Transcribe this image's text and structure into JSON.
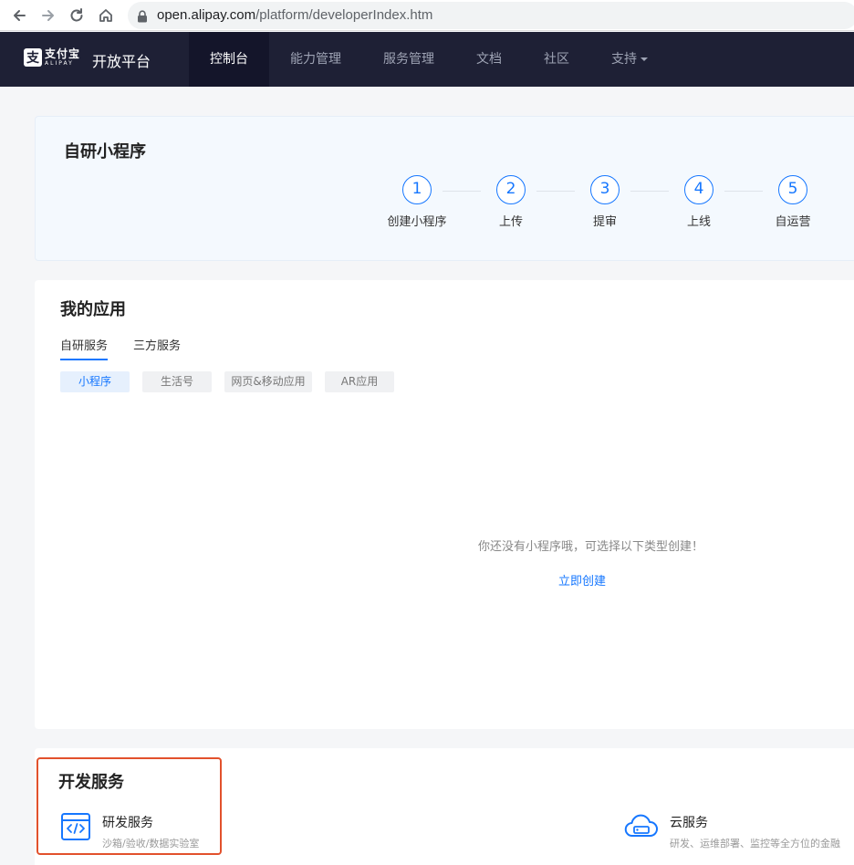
{
  "browser": {
    "url_host": "open.alipay.com",
    "url_path": "/platform/developerIndex.htm"
  },
  "nav": {
    "logo_mark": "支",
    "logo_cn": "支付宝",
    "logo_en": "ALIPAY",
    "platform": "开放平台",
    "items": [
      {
        "label": "控制台",
        "active": true
      },
      {
        "label": "能力管理"
      },
      {
        "label": "服务管理"
      },
      {
        "label": "文档"
      },
      {
        "label": "社区"
      },
      {
        "label": "支持"
      }
    ]
  },
  "miniapp": {
    "title": "自研小程序",
    "steps": [
      {
        "num": "1",
        "label": "创建小程序"
      },
      {
        "num": "2",
        "label": "上传"
      },
      {
        "num": "3",
        "label": "提审"
      },
      {
        "num": "4",
        "label": "上线"
      },
      {
        "num": "5",
        "label": "自运营"
      }
    ]
  },
  "apps": {
    "title": "我的应用",
    "tabs": [
      "自研服务",
      "三方服务"
    ],
    "chips": [
      "小程序",
      "生活号",
      "网页&移动应用",
      "AR应用"
    ],
    "empty_text": "你还没有小程序哦，可选择以下类型创建！",
    "create_link": "立即创建"
  },
  "dev": {
    "title": "开发服务",
    "services": [
      {
        "title": "研发服务",
        "desc": "沙箱/验收/数据实验室",
        "icon": "code-window-icon"
      },
      {
        "title": "云服务",
        "desc": "研发、运维部署、监控等全方位的金融",
        "icon": "cloud-server-icon"
      }
    ]
  },
  "colors": {
    "nav_bg": "#1e2035",
    "accent": "#1677ff",
    "highlight": "#e2512c"
  }
}
